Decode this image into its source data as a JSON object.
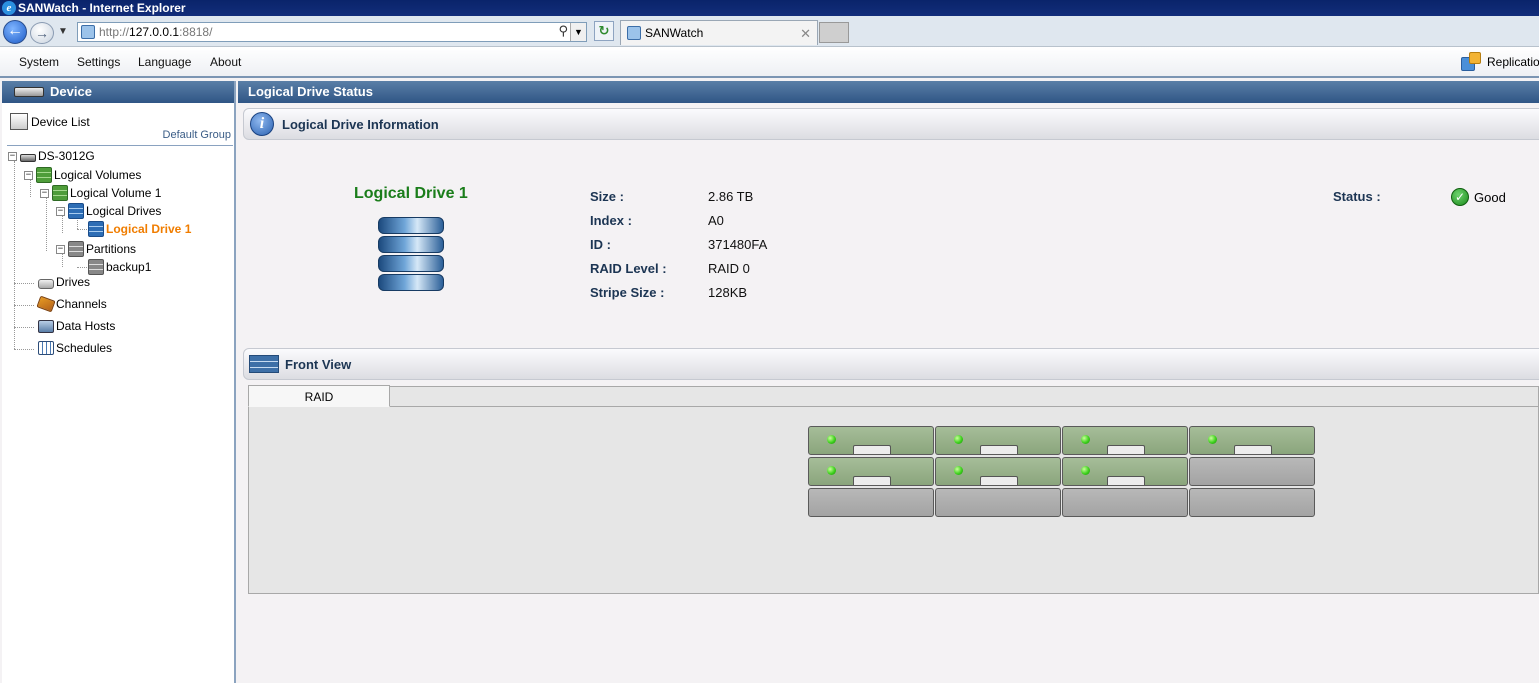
{
  "window": {
    "title": "SANWatch - Internet Explorer"
  },
  "browser": {
    "url_prefix": "http://",
    "url_host": "127.0.0.1",
    "url_suffix": ":8818/",
    "tab_title": "SANWatch"
  },
  "menu": {
    "items": [
      "System",
      "Settings",
      "Language",
      "About"
    ],
    "replication_label": "Replicatio"
  },
  "sidebar": {
    "header": "Device",
    "device_list_label": "Device List",
    "group_label": "Default Group",
    "tree": {
      "device": "DS-3012G",
      "logical_volumes": "Logical Volumes",
      "logical_volume_1": "Logical Volume 1",
      "logical_drives": "Logical Drives",
      "logical_drive_1": "Logical Drive 1",
      "partitions": "Partitions",
      "backup1": "backup1",
      "drives": "Drives",
      "channels": "Channels",
      "data_hosts": "Data Hosts",
      "schedules": "Schedules"
    }
  },
  "main": {
    "header": "Logical Drive Status",
    "info_section_title": "Logical Drive Information",
    "drive_name": "Logical Drive 1",
    "fields": [
      {
        "label": "Size :",
        "value": "2.86 TB"
      },
      {
        "label": "Index :",
        "value": "A0"
      },
      {
        "label": "ID :",
        "value": "371480FA"
      },
      {
        "label": "RAID Level :",
        "value": "RAID 0"
      },
      {
        "label": "Stripe Size :",
        "value": "128KB"
      }
    ],
    "status_label": "Status :",
    "status_value": "Good",
    "front_view_title": "Front View",
    "front_view_tab": "RAID",
    "enclosure_slots": [
      [
        true,
        true,
        true,
        true
      ],
      [
        true,
        true,
        true,
        false
      ],
      [
        false,
        false,
        false,
        false
      ]
    ]
  }
}
